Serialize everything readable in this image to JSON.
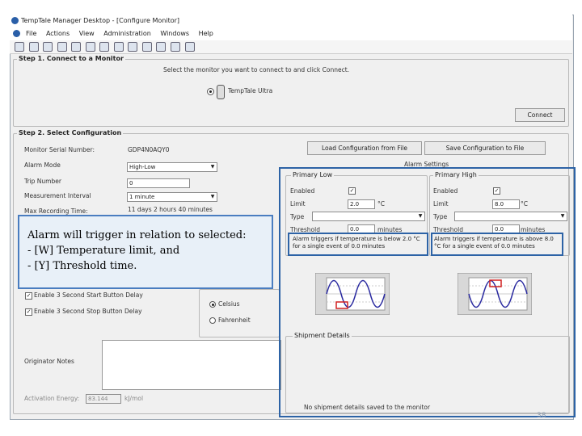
{
  "window": {
    "title": "TempTale Manager Desktop - [Configure Monitor]"
  },
  "menu": [
    "File",
    "Actions",
    "View",
    "Administration",
    "Windows",
    "Help"
  ],
  "step1": {
    "title": "Step 1. Connect to a Monitor",
    "instruction": "Select the monitor you want to connect to and click Connect.",
    "device": "TempTale Ultra",
    "connect_button": "Connect"
  },
  "step2": {
    "title": "Step 2. Select Configuration",
    "load_button": "Load Configuration from File",
    "save_button": "Save Configuration to File",
    "fields": {
      "serial_label": "Monitor Serial Number:",
      "serial_value": "GDP4N0AQY0",
      "alarm_mode_label": "Alarm Mode",
      "alarm_mode_value": "High-Low",
      "trip_label": "Trip Number",
      "trip_value": "0",
      "interval_label": "Measurement Interval",
      "interval_value": "1 minute",
      "max_time_label": "Max Recording Time:",
      "max_time_value": "11 days 2 hours 40 minutes"
    },
    "checkbox_start": "Enable 3 Second Start Button Delay",
    "checkbox_stop": "Enable 3 Second Stop Button Delay",
    "temp_celsius": "Celsius",
    "temp_fahrenheit": "Fahrenheit",
    "originator_label": "Originator Notes",
    "activation_label": "Activation Energy:",
    "activation_value": "83.144",
    "activation_unit": "kJ/mol"
  },
  "alarm_settings": {
    "title": "Alarm Settings",
    "primary_low": {
      "title": "Primary Low",
      "enabled_label": "Enabled",
      "limit_label": "Limit",
      "limit_value": "2.0",
      "unit": "°C",
      "type_label": "Type",
      "threshold_label": "Threshold",
      "threshold_value": "0.0",
      "threshold_unit": "minutes",
      "summary": "Alarm triggers if temperature is below 2.0 °C for a single event of 0.0 minutes"
    },
    "primary_high": {
      "title": "Primary High",
      "enabled_label": "Enabled",
      "limit_label": "Limit",
      "limit_value": "8.0",
      "unit": "°C",
      "type_label": "Type",
      "threshold_label": "Threshold",
      "threshold_value": "0.0",
      "threshold_unit": "minutes",
      "summary": "Alarm triggers if temperature is above 8.0 °C for a single event of 0.0 minutes"
    }
  },
  "shipment": {
    "title": "Shipment Details",
    "empty_text": "No shipment details saved to the monitor"
  },
  "callout": {
    "line1": "Alarm will trigger in relation to selected:",
    "line2": "-   [W] Temperature limit, and",
    "line3": "-   [Y] Threshold time."
  },
  "page_number": "38",
  "colors": {
    "highlight_border": "#2d63a6",
    "callout_bg": "#e8f0f8",
    "chart_wave": "#2a2aa0",
    "chart_alarm": "#d02020"
  }
}
